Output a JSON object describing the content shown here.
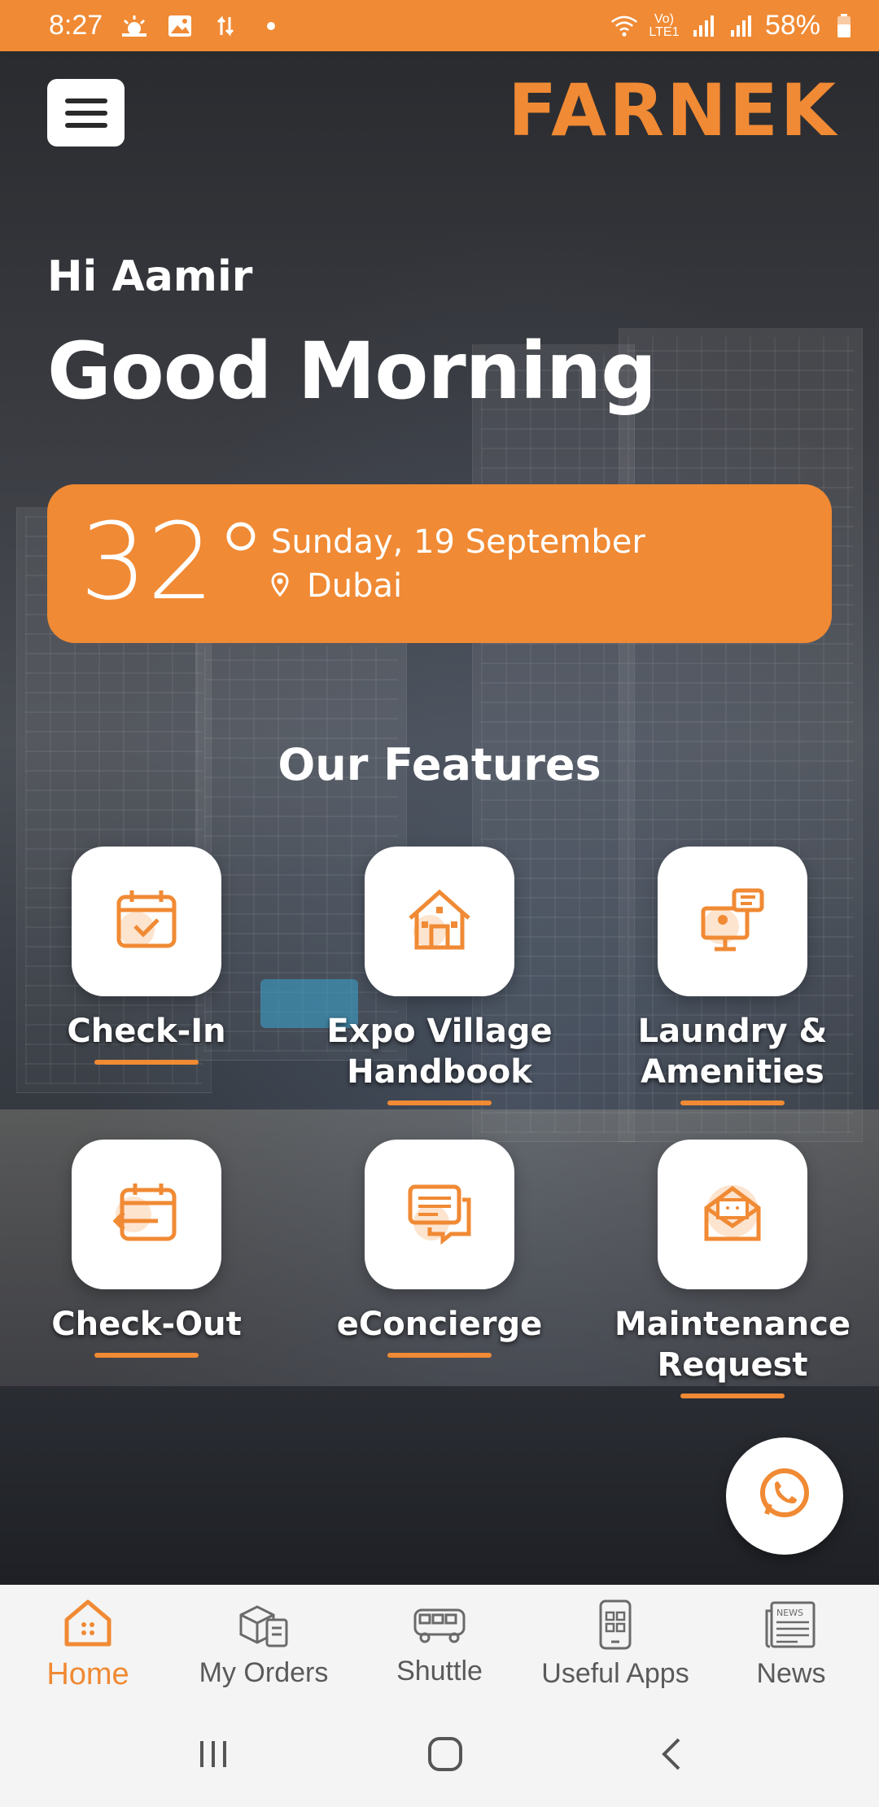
{
  "status_bar": {
    "time": "8:27",
    "battery": "58%",
    "network_label": "Vo) LTE1",
    "icons": [
      "weather-icon",
      "image-icon",
      "data-transfer-icon",
      "dot-icon",
      "wifi-icon",
      "signal-icon",
      "roaming-signal-icon",
      "battery-icon"
    ]
  },
  "header": {
    "menu_icon": "hamburger-menu-icon",
    "logo": "FARNEK"
  },
  "greeting": {
    "hi": "Hi Aamir",
    "headline": "Good Morning"
  },
  "weather": {
    "temperature": "32°",
    "date": "Sunday, 19 September",
    "location": "Dubai"
  },
  "features": {
    "title": "Our Features",
    "items": [
      {
        "label": "Check-In",
        "icon": "calendar-check-icon"
      },
      {
        "label": "Expo Village\nHandbook",
        "icon": "house-icon"
      },
      {
        "label": "Laundry &\nAmenities",
        "icon": "desk-chat-icon"
      },
      {
        "label": "Check-Out",
        "icon": "calendar-exit-icon"
      },
      {
        "label": "eConcierge",
        "icon": "chat-bubbles-icon"
      },
      {
        "label": "Maintenance\nRequest",
        "icon": "envelope-icon"
      }
    ]
  },
  "fab": {
    "icon": "whatsapp-icon"
  },
  "bottom_nav": [
    {
      "label": "Home",
      "icon": "home-icon",
      "active": true
    },
    {
      "label": "My Orders",
      "icon": "orders-icon",
      "active": false
    },
    {
      "label": "Shuttle",
      "icon": "bus-icon",
      "active": false
    },
    {
      "label": "Useful Apps",
      "icon": "apps-phone-icon",
      "active": false
    },
    {
      "label": "News",
      "icon": "newspaper-icon",
      "active": false
    }
  ],
  "system_nav": [
    "recent-apps-icon",
    "home-circle-icon",
    "back-icon"
  ],
  "colors": {
    "accent": "#f08a34",
    "nav_bg": "#f4f4f4",
    "nav_inactive": "#5a5a5a"
  }
}
